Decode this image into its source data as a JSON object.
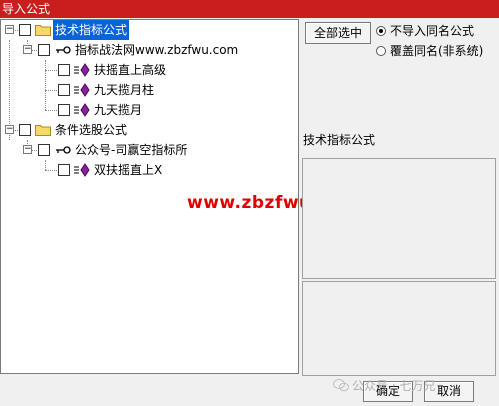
{
  "window": {
    "title": "导入公式"
  },
  "tree": {
    "groups": [
      {
        "label": "技术指标公式",
        "children": [
          {
            "label": "指标战法网www.zbzfwu.com",
            "formulas": [
              "扶摇直上高级",
              "九天揽月柱",
              "九天揽月"
            ]
          }
        ]
      },
      {
        "label": "条件选股公式",
        "children": [
          {
            "label": "公众号-司赢空指标所",
            "formulas": [
              "双扶摇直上X"
            ]
          }
        ]
      }
    ]
  },
  "buttons": {
    "select_all": "全部选中",
    "ok": "确定",
    "cancel": "取消"
  },
  "options": {
    "no_import_same_name": "不导入同名公式",
    "overwrite_same_name": "覆盖同名(非系统)",
    "selected": "no_import_same_name"
  },
  "description": {
    "title": "技术指标公式"
  },
  "watermark": {
    "text": "www.zbzfwu.com",
    "color": "#e00000"
  },
  "footer_watermark": {
    "text": "公众号 · 七万兄"
  },
  "colors": {
    "titlebar": "#c81e1e",
    "selection": "#0a64d8",
    "formula_icon": "#8b1fa0"
  }
}
